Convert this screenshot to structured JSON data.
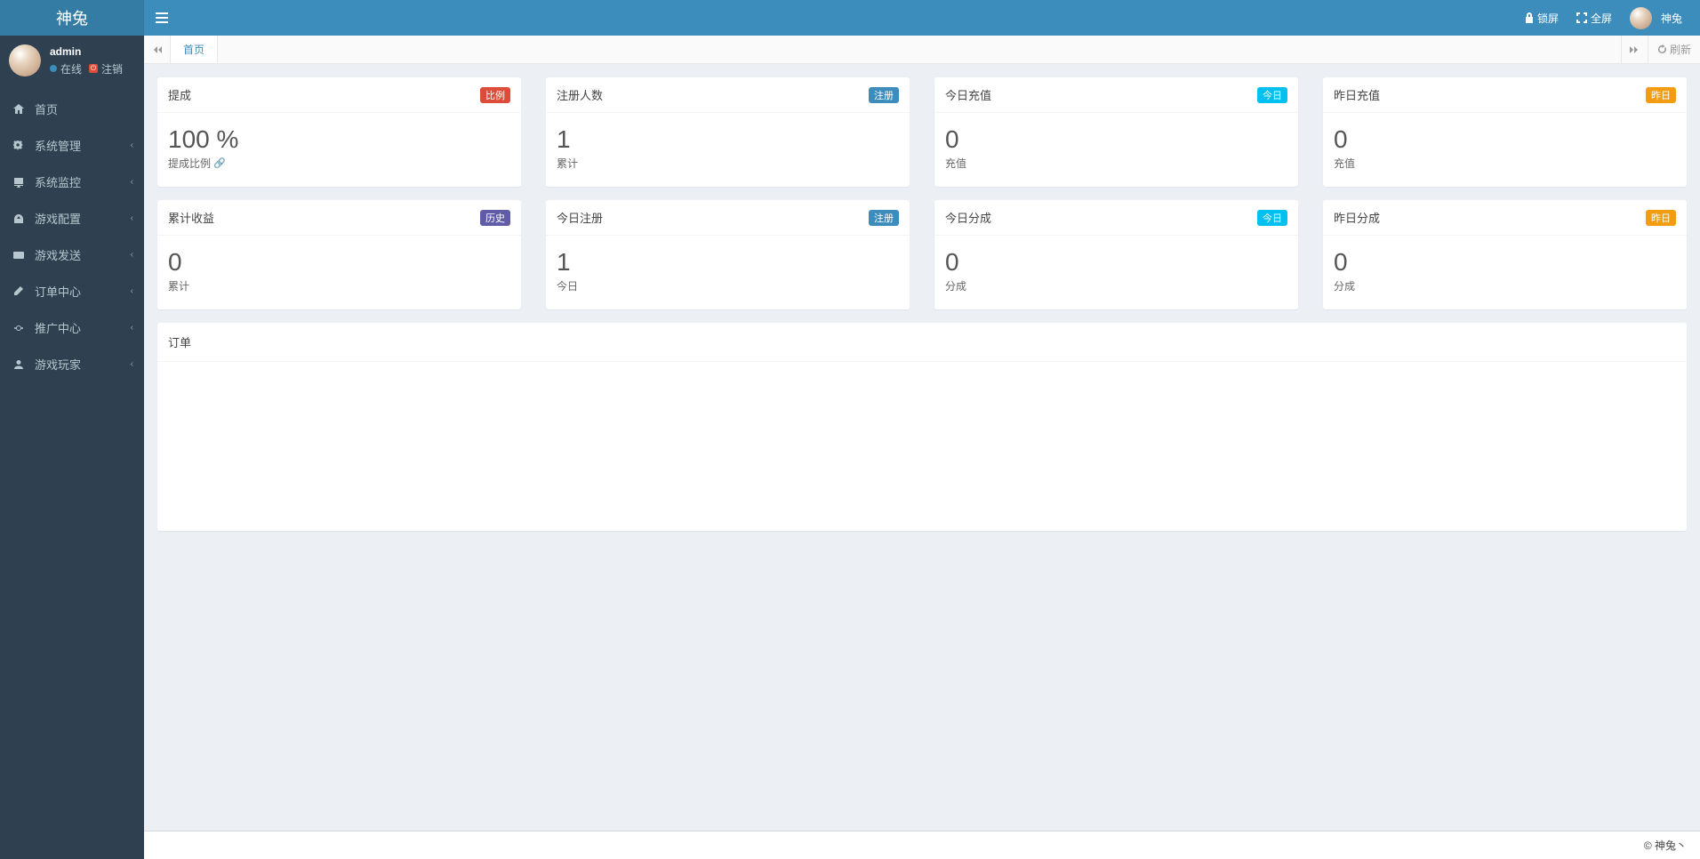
{
  "brand": "神兔",
  "header": {
    "lock": "锁屏",
    "fullscreen": "全屏",
    "username": "神兔"
  },
  "user_panel": {
    "name": "admin",
    "online": "在线",
    "logout": "注销"
  },
  "menu": [
    {
      "icon": "home",
      "label": "首页",
      "expandable": false
    },
    {
      "icon": "gear",
      "label": "系统管理",
      "expandable": true
    },
    {
      "icon": "monitor",
      "label": "系统监控",
      "expandable": true
    },
    {
      "icon": "dashboard",
      "label": "游戏配置",
      "expandable": true
    },
    {
      "icon": "send",
      "label": "游戏发送",
      "expandable": true
    },
    {
      "icon": "edit",
      "label": "订单中心",
      "expandable": true
    },
    {
      "icon": "share",
      "label": "推广中心",
      "expandable": true
    },
    {
      "icon": "user",
      "label": "游戏玩家",
      "expandable": true
    }
  ],
  "tabs": {
    "home": "首页",
    "refresh": "刷新"
  },
  "cards_row1": [
    {
      "title": "提成",
      "badge": "比例",
      "badge_color": "bg-red",
      "value": "100 %",
      "sub": "提成比例",
      "link": true
    },
    {
      "title": "注册人数",
      "badge": "注册",
      "badge_color": "bg-blue",
      "value": "1",
      "sub": "累计",
      "link": false
    },
    {
      "title": "今日充值",
      "badge": "今日",
      "badge_color": "bg-teal",
      "value": "0",
      "sub": "充值",
      "link": false
    },
    {
      "title": "昨日充值",
      "badge": "昨日",
      "badge_color": "bg-orange",
      "value": "0",
      "sub": "充值",
      "link": false
    }
  ],
  "cards_row2": [
    {
      "title": "累计收益",
      "badge": "历史",
      "badge_color": "bg-purple",
      "value": "0",
      "sub": "累计",
      "link": false
    },
    {
      "title": "今日注册",
      "badge": "注册",
      "badge_color": "bg-blue",
      "value": "1",
      "sub": "今日",
      "link": false
    },
    {
      "title": "今日分成",
      "badge": "今日",
      "badge_color": "bg-teal",
      "value": "0",
      "sub": "分成",
      "link": false
    },
    {
      "title": "昨日分成",
      "badge": "昨日",
      "badge_color": "bg-orange",
      "value": "0",
      "sub": "分成",
      "link": false
    }
  ],
  "order_section": {
    "title": "订单"
  },
  "footer": "© 神兔丶"
}
